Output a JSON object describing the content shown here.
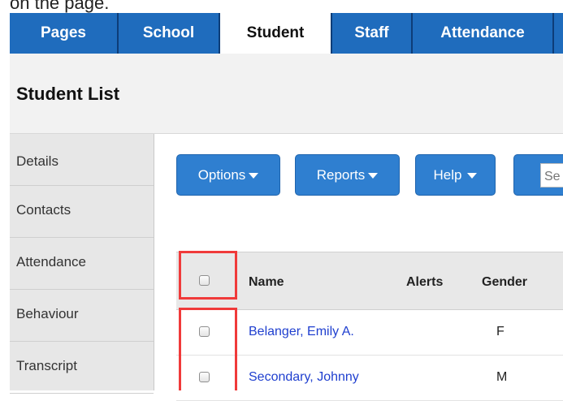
{
  "caption": "on the page.",
  "topnav": {
    "tabs": [
      {
        "label": "Pages"
      },
      {
        "label": "School"
      },
      {
        "label": "Student",
        "active": true
      },
      {
        "label": "Staff"
      },
      {
        "label": "Attendance"
      }
    ]
  },
  "header": {
    "title": "Student List"
  },
  "sidebar": {
    "items": [
      {
        "label": "Details"
      },
      {
        "label": "Contacts"
      },
      {
        "label": "Attendance"
      },
      {
        "label": "Behaviour"
      },
      {
        "label": "Transcript"
      }
    ]
  },
  "toolbar": {
    "options_label": "Options",
    "reports_label": "Reports",
    "help_label": "Help",
    "search_placeholder": "Se"
  },
  "table": {
    "columns": [
      "Name",
      "Alerts",
      "Gender"
    ],
    "rows": [
      {
        "name": "Belanger, Emily A.",
        "alerts": "",
        "gender": "F"
      },
      {
        "name": "Secondary, Johnny",
        "alerts": "",
        "gender": "M"
      }
    ]
  },
  "colors": {
    "nav_blue": "#1f6cbd",
    "button_blue": "#2f7fd0",
    "highlight_red": "#f03a3a",
    "link_blue": "#1f3fcf"
  }
}
